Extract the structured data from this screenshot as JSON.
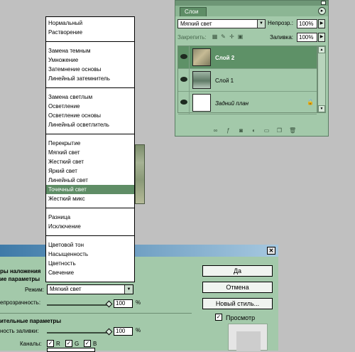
{
  "layers_panel": {
    "tab_label": "Слои",
    "menu_icon": "arrow-right-icon",
    "blend_mode_value": "Мягкий свет",
    "opacity_label": "Непрозр.:",
    "opacity_value": "100%",
    "lock_label": "Закрепить:",
    "lock_icons": [
      "lock-transparent-icon",
      "lock-paint-icon",
      "lock-move-icon",
      "lock-all-icon"
    ],
    "fill_label": "Заливка:",
    "fill_value": "100%",
    "layers": [
      {
        "name": "Слой 2",
        "active": true,
        "thumbnail": "textured-photo"
      },
      {
        "name": "Слой 1",
        "active": false,
        "thumbnail": "person-photo"
      },
      {
        "name": "Задний план",
        "active": false,
        "thumbnail": "white",
        "locked": true
      }
    ],
    "bottom_icons": [
      "link-icon",
      "fx-icon",
      "mask-icon",
      "adjustment-icon",
      "folder-icon",
      "new-layer-icon",
      "trash-icon"
    ]
  },
  "blend_menu": {
    "groups": [
      [
        "Нормальный",
        "Растворение"
      ],
      [
        "Замена темным",
        "Умножение",
        "Затемнение основы",
        "Линейный затемнитель"
      ],
      [
        "Замена светлым",
        "Осветление",
        "Осветление основы",
        "Линейный осветлитель"
      ],
      [
        "Перекрытие",
        "Мягкий свет",
        "Жесткий свет",
        "Яркий свет",
        "Линейный свет",
        "Точечный свет",
        "Жесткий микс"
      ],
      [
        "Разница",
        "Исключение"
      ],
      [
        "Цветовой тон",
        "Насыщенность",
        "Цветность",
        "Свечение"
      ]
    ],
    "selected": "Точечный свет"
  },
  "style_dialog": {
    "section_blend_title": "ры наложения",
    "subsection_general": "ие параметры",
    "mode_label": "Режим:",
    "mode_value": "Мягкий свет",
    "opacity_label": "епрозрачность:",
    "opacity_value": "100",
    "opacity_unit": "%",
    "section_advanced": "ительные параметры",
    "fill_label": "ность заливки:",
    "fill_value": "100",
    "fill_unit": "%",
    "channels_label": "Каналы:",
    "channels": [
      {
        "label": "R",
        "checked": true
      },
      {
        "label": "G",
        "checked": true
      },
      {
        "label": "B",
        "checked": true
      }
    ],
    "ok_label": "Да",
    "cancel_label": "Отмена",
    "new_style_label": "Новый стиль...",
    "preview_label": "Просмотр",
    "preview_checked": true,
    "close_icon": "close-icon"
  }
}
